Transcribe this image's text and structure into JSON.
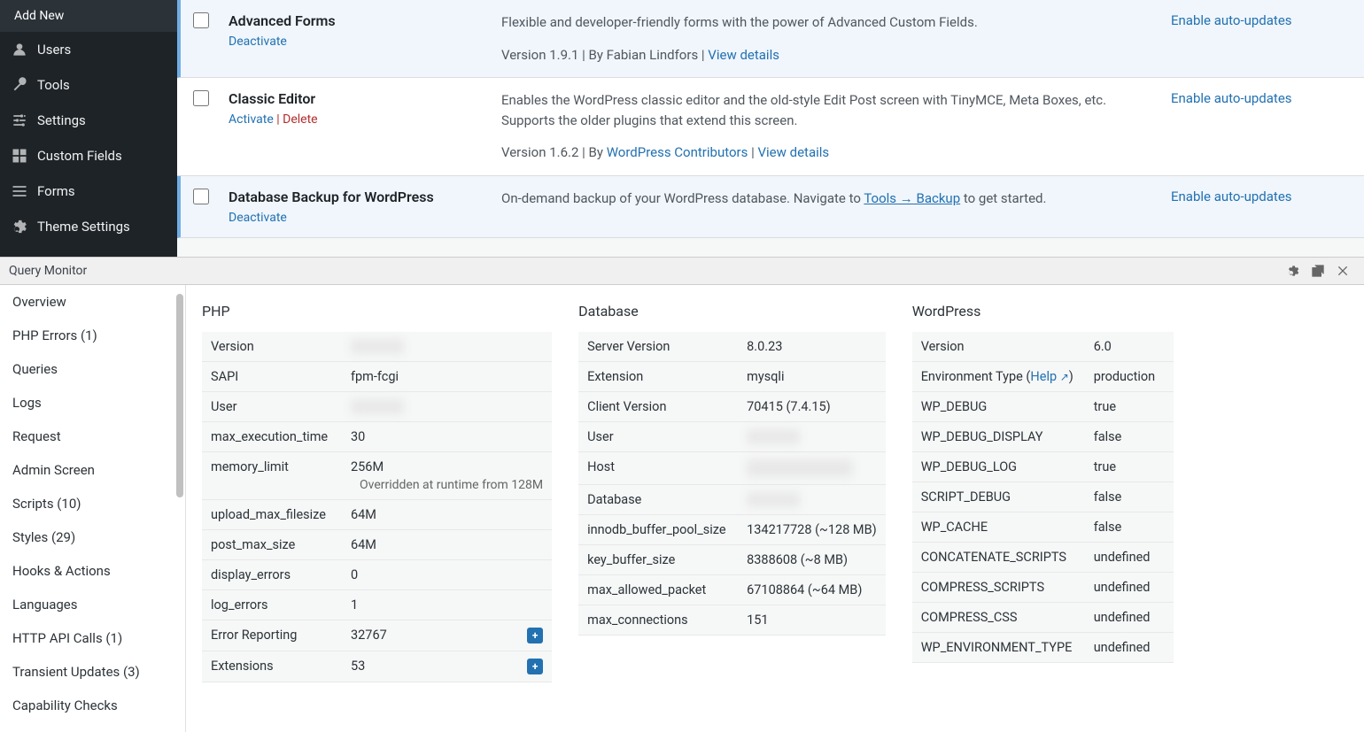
{
  "wp_sidebar": {
    "addnew": "Add New",
    "items": [
      {
        "icon": "users",
        "label": "Users"
      },
      {
        "icon": "wrench",
        "label": "Tools"
      },
      {
        "icon": "sliders",
        "label": "Settings"
      },
      {
        "icon": "grid",
        "label": "Custom Fields"
      },
      {
        "icon": "list",
        "label": "Forms"
      },
      {
        "icon": "gear",
        "label": "Theme Settings"
      }
    ]
  },
  "plugins": [
    {
      "active": true,
      "name": "Advanced Forms",
      "actions": [
        {
          "label": "Deactivate",
          "kind": "link"
        }
      ],
      "desc_lines": [
        "Flexible and developer-friendly forms with the power of Advanced Custom Fields."
      ],
      "meta_pre": "Version 1.9.1 | By Fabian Lindfors | ",
      "meta_links": [
        {
          "label": "View details"
        }
      ],
      "auto": "Enable auto-updates"
    },
    {
      "active": false,
      "name": "Classic Editor",
      "actions": [
        {
          "label": "Activate",
          "kind": "link"
        },
        {
          "sep": " | "
        },
        {
          "label": "Delete",
          "kind": "del"
        }
      ],
      "desc_lines": [
        "Enables the WordPress classic editor and the old-style Edit Post screen with TinyMCE, Meta Boxes, etc. Supports the older plugins that extend this screen."
      ],
      "meta_pre": "Version 1.6.2 | By ",
      "meta_links": [
        {
          "label": "WordPress Contributors"
        },
        {
          "sep": " | "
        },
        {
          "label": "View details"
        }
      ],
      "auto": "Enable auto-updates"
    },
    {
      "active": true,
      "name": "Database Backup for WordPress",
      "actions": [
        {
          "label": "Deactivate",
          "kind": "link"
        }
      ],
      "desc_lines_rich": {
        "pre": "On-demand backup of your WordPress database. Navigate to ",
        "link": "Tools → Backup",
        "post": " to get started."
      },
      "auto": "Enable auto-updates"
    }
  ],
  "qm": {
    "title": "Query Monitor",
    "nav": [
      "Overview",
      "PHP Errors (1)",
      "Queries",
      "Logs",
      "Request",
      "Admin Screen",
      "Scripts (10)",
      "Styles (29)",
      "Hooks & Actions",
      "Languages",
      "HTTP API Calls (1)",
      "Transient Updates (3)",
      "Capability Checks"
    ],
    "php": {
      "title": "PHP",
      "rows": [
        {
          "k": "Version",
          "blur": true
        },
        {
          "k": "SAPI",
          "v": "fpm-fcgi"
        },
        {
          "k": "User",
          "blur": true
        },
        {
          "k": "max_execution_time",
          "v": "30"
        },
        {
          "k": "memory_limit",
          "v": "256M",
          "sub": "Overridden at runtime from 128M"
        },
        {
          "k": "upload_max_filesize",
          "v": "64M"
        },
        {
          "k": "post_max_size",
          "v": "64M"
        },
        {
          "k": "display_errors",
          "v": "0"
        },
        {
          "k": "log_errors",
          "v": "1"
        },
        {
          "k": "Error Reporting",
          "v": "32767",
          "plus": true
        },
        {
          "k": "Extensions",
          "v": "53",
          "plus": true
        }
      ]
    },
    "db": {
      "title": "Database",
      "rows": [
        {
          "k": "Server Version",
          "v": "8.0.23"
        },
        {
          "k": "Extension",
          "v": "mysqli"
        },
        {
          "k": "Client Version",
          "v": "70415 (7.4.15)"
        },
        {
          "k": "User",
          "blur": true
        },
        {
          "k": "Host",
          "blur": true,
          "bigblur": true
        },
        {
          "k": "Database",
          "blur": true
        },
        {
          "k": "innodb_buffer_pool_size",
          "v": "134217728 (~128 MB)"
        },
        {
          "k": "key_buffer_size",
          "v": "8388608 (~8 MB)"
        },
        {
          "k": "max_allowed_packet",
          "v": "67108864 (~64 MB)"
        },
        {
          "k": "max_connections",
          "v": "151"
        }
      ]
    },
    "wp": {
      "title": "WordPress",
      "rows": [
        {
          "k": "Version",
          "v": "6.0"
        },
        {
          "k_rich": {
            "pre": "Environment Type (",
            "link": "Help",
            "ext": true,
            "post": ")"
          },
          "v": "production"
        },
        {
          "k": "WP_DEBUG",
          "v": "true"
        },
        {
          "k": "WP_DEBUG_DISPLAY",
          "v": "false"
        },
        {
          "k": "WP_DEBUG_LOG",
          "v": "true"
        },
        {
          "k": "SCRIPT_DEBUG",
          "v": "false"
        },
        {
          "k": "WP_CACHE",
          "v": "false"
        },
        {
          "k": "CONCATENATE_SCRIPTS",
          "v": "undefined"
        },
        {
          "k": "COMPRESS_SCRIPTS",
          "v": "undefined"
        },
        {
          "k": "COMPRESS_CSS",
          "v": "undefined"
        },
        {
          "k": "WP_ENVIRONMENT_TYPE",
          "v": "undefined"
        }
      ]
    }
  }
}
